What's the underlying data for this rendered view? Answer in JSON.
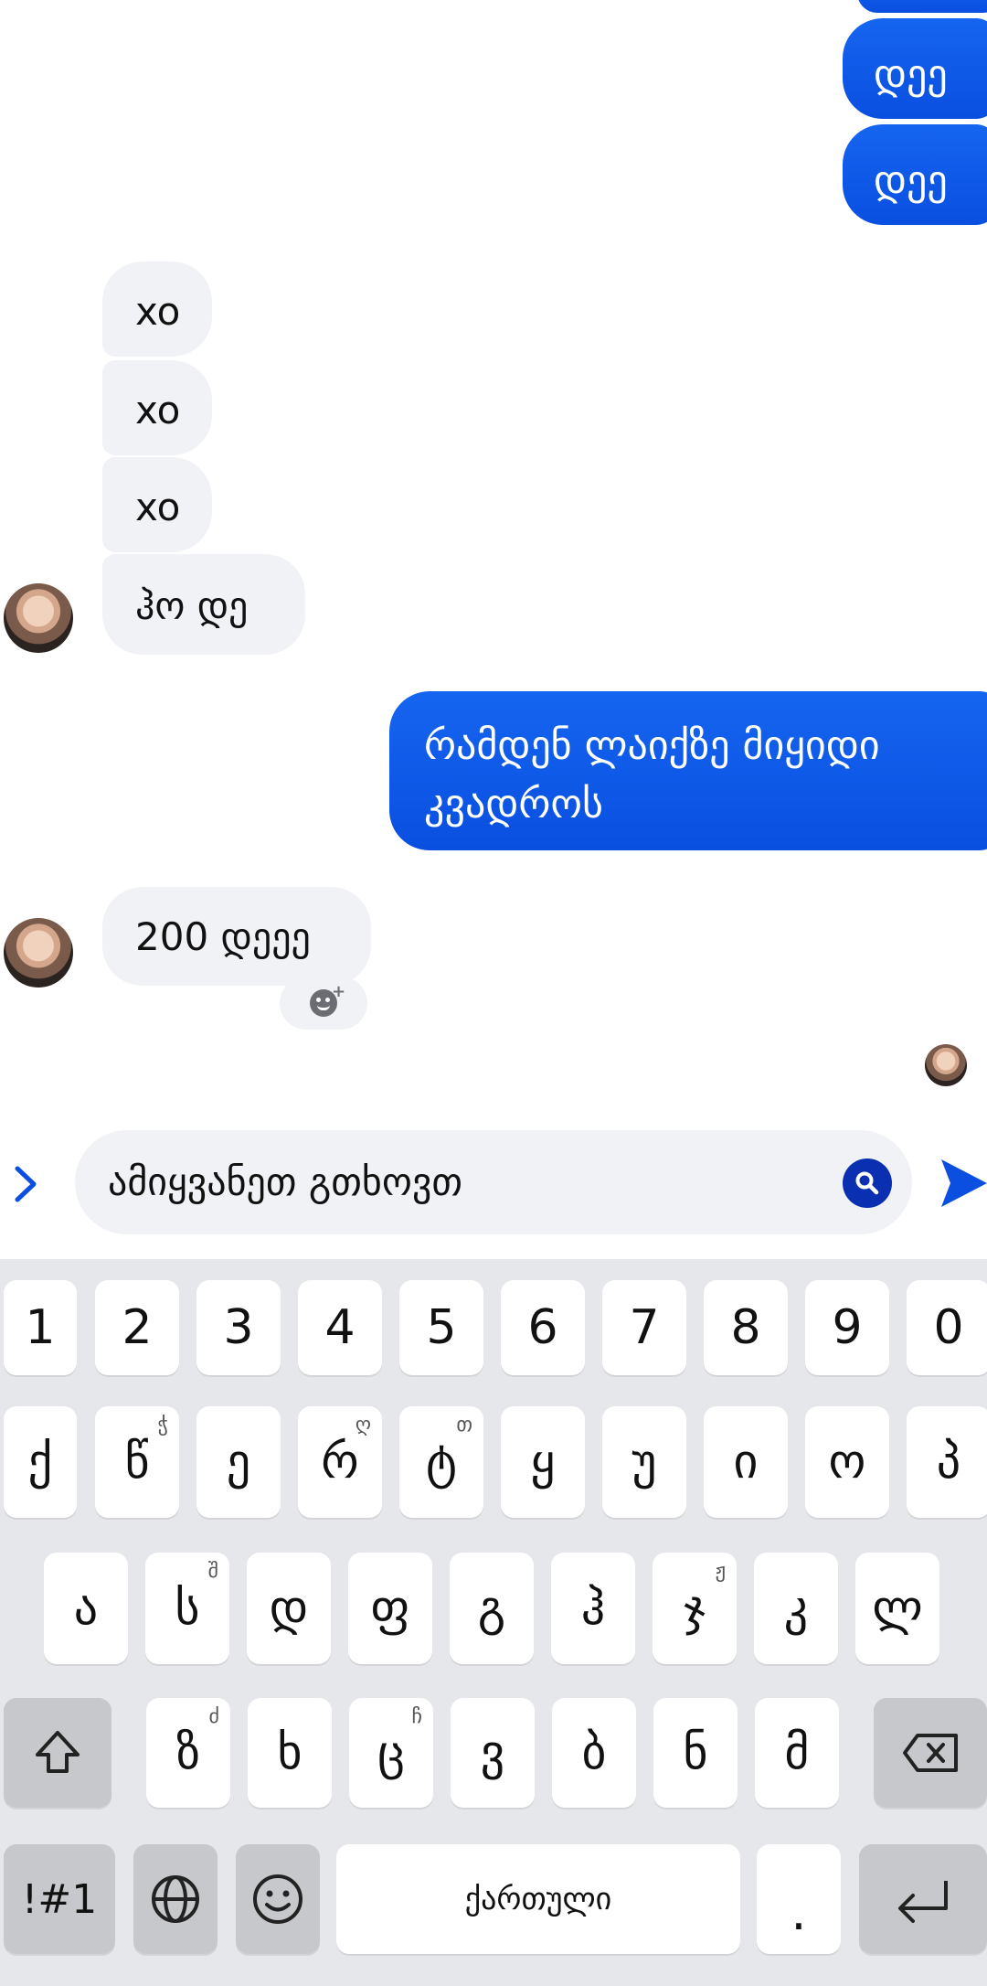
{
  "chat": {
    "outgoing_1": "დეე",
    "outgoing_2": "დეე",
    "incoming_1": "xo",
    "incoming_2": "xo",
    "incoming_3": "xo",
    "incoming_4": "ჰო დე",
    "outgoing_3": "რამდენ ლაიქზე მიყიდი კვადროს",
    "incoming_5": "200 დეეე"
  },
  "composer": {
    "text": "ამიყვანეთ გთხოვთ"
  },
  "keyboard": {
    "row_numbers": [
      "1",
      "2",
      "3",
      "4",
      "5",
      "6",
      "7",
      "8",
      "9",
      "0"
    ],
    "row1": [
      {
        "k": "ქ",
        "h": ""
      },
      {
        "k": "წ",
        "h": "ჭ"
      },
      {
        "k": "ე",
        "h": ""
      },
      {
        "k": "რ",
        "h": "ღ"
      },
      {
        "k": "ტ",
        "h": "თ"
      },
      {
        "k": "ყ",
        "h": ""
      },
      {
        "k": "უ",
        "h": ""
      },
      {
        "k": "ი",
        "h": ""
      },
      {
        "k": "ო",
        "h": ""
      },
      {
        "k": "პ",
        "h": ""
      }
    ],
    "row2": [
      {
        "k": "ა",
        "h": ""
      },
      {
        "k": "ს",
        "h": "შ"
      },
      {
        "k": "დ",
        "h": ""
      },
      {
        "k": "ფ",
        "h": ""
      },
      {
        "k": "გ",
        "h": ""
      },
      {
        "k": "ჰ",
        "h": ""
      },
      {
        "k": "ჯ",
        "h": "ჟ"
      },
      {
        "k": "კ",
        "h": ""
      },
      {
        "k": "ლ",
        "h": ""
      }
    ],
    "row3": [
      {
        "k": "ზ",
        "h": "ძ"
      },
      {
        "k": "ხ",
        "h": ""
      },
      {
        "k": "ც",
        "h": "ჩ"
      },
      {
        "k": "ვ",
        "h": ""
      },
      {
        "k": "ბ",
        "h": ""
      },
      {
        "k": "ნ",
        "h": ""
      },
      {
        "k": "მ",
        "h": ""
      }
    ],
    "symbols_label": "!#1",
    "space_label": "ქართული",
    "period_label": "."
  }
}
